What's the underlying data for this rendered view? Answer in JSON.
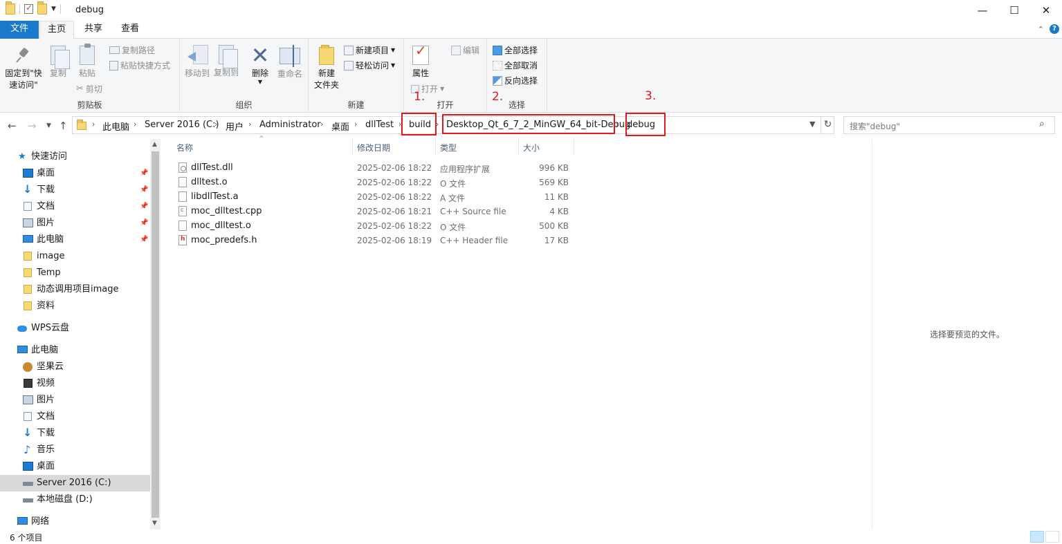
{
  "window": {
    "title": "debug"
  },
  "tabs": {
    "file": "文件",
    "home": "主页",
    "share": "共享",
    "view": "查看"
  },
  "ribbon": {
    "clipboard": {
      "label": "剪贴板",
      "pin": "固定到\"快速访问\"",
      "pin_line1": "固定到\"快",
      "pin_line2": "速访问\"",
      "copy": "复制",
      "paste": "粘贴",
      "copy_path": "复制路径",
      "paste_shortcut": "粘贴快捷方式",
      "cut": "剪切"
    },
    "organize": {
      "label": "组织",
      "move_to": "移动到",
      "copy_to": "复制到",
      "delete": "删除",
      "rename": "重命名"
    },
    "new": {
      "label": "新建",
      "new_folder_line1": "新建",
      "new_folder_line2": "文件夹",
      "new_item": "新建项目",
      "easy_access": "轻松访问"
    },
    "open": {
      "label": "打开",
      "properties": "属性",
      "open": "打开",
      "edit": "编辑"
    },
    "select": {
      "label": "选择",
      "select_all": "全部选择",
      "select_none": "全部取消",
      "invert": "反向选择"
    }
  },
  "breadcrumb": [
    "此电脑",
    "Server 2016 (C:)",
    "用户",
    "Administrator",
    "桌面",
    "dllTest",
    "build",
    "Desktop_Qt_6_7_2_MinGW_64_bit-Debug",
    "debug"
  ],
  "search": {
    "placeholder": "搜索\"debug\""
  },
  "annotations": {
    "a1": "1.",
    "a2": "2.",
    "a3": "3."
  },
  "nav": {
    "quick_access": "快速访问",
    "quick_items": [
      "桌面",
      "下载",
      "文档",
      "图片",
      "此电脑",
      "image",
      "Temp",
      "动态调用项目image",
      "资料"
    ],
    "wps": "WPS云盘",
    "this_pc": "此电脑",
    "pc_items": [
      "坚果云",
      "视频",
      "图片",
      "文档",
      "下载",
      "音乐",
      "桌面",
      "Server 2016 (C:)",
      "本地磁盘 (D:)"
    ],
    "network": "网络"
  },
  "columns": {
    "name": "名称",
    "date": "修改日期",
    "type": "类型",
    "size": "大小"
  },
  "files": [
    {
      "name": "dllTest.dll",
      "date": "2025-02-06 18:22",
      "type": "应用程序扩展",
      "size": "996 KB"
    },
    {
      "name": "dlltest.o",
      "date": "2025-02-06 18:22",
      "type": "O 文件",
      "size": "569 KB"
    },
    {
      "name": "libdllTest.a",
      "date": "2025-02-06 18:22",
      "type": "A 文件",
      "size": "11 KB"
    },
    {
      "name": "moc_dlltest.cpp",
      "date": "2025-02-06 18:21",
      "type": "C++ Source file",
      "size": "4 KB"
    },
    {
      "name": "moc_dlltest.o",
      "date": "2025-02-06 18:22",
      "type": "O 文件",
      "size": "500 KB"
    },
    {
      "name": "moc_predefs.h",
      "date": "2025-02-06 18:19",
      "type": "C++ Header file",
      "size": "17 KB"
    }
  ],
  "preview": {
    "message": "选择要预览的文件。"
  },
  "status": {
    "count": "6 个项目"
  },
  "colors": {
    "accent": "#1979ca",
    "annotation": "#e3161b",
    "folder": "#f8d775"
  }
}
